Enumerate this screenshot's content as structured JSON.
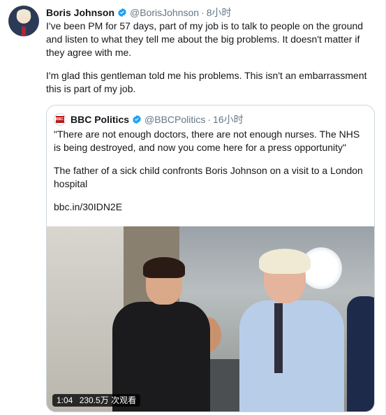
{
  "tweet": {
    "author_name": "Boris Johnson",
    "author_handle": "@BorisJohnson",
    "separator": "·",
    "timestamp": "8小时",
    "paragraphs": [
      "I've been PM for 57 days, part of my job is to talk to people on the ground and listen to what they tell me about the big problems. It doesn't matter if they agree with me.",
      "I'm glad this gentleman told me his problems. This isn't an embarrassment this is part of my job."
    ]
  },
  "quoted_tweet": {
    "author_name": "BBC Politics",
    "author_handle": "@BBCPolitics",
    "separator": "·",
    "timestamp": "16小时",
    "avatar_text": "BBC NEWS",
    "paragraphs": [
      "\"There are not enough doctors, there are not enough nurses. The NHS is being destroyed, and now you come here for a press opportunity\"",
      "The father of a sick child confronts Boris Johnson on a visit to a London hospital",
      "bbc.in/30IDN2E"
    ],
    "video": {
      "duration": "1:04",
      "views": "230.5万 次观看"
    }
  },
  "colors": {
    "verified": "#1da1f2",
    "link_gray": "#657786",
    "border": "#ccd6dd"
  },
  "icons": {
    "verified": "verified-badge-icon"
  }
}
